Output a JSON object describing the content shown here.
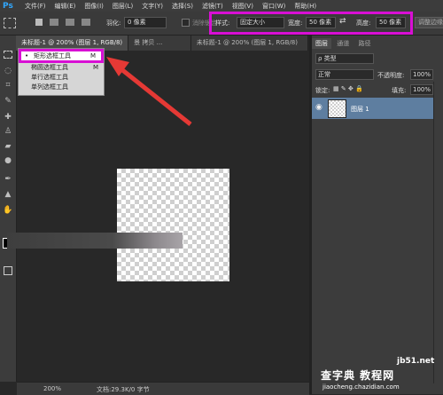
{
  "menubar": {
    "logo": "Ps",
    "items": [
      "文件(F)",
      "编辑(E)",
      "图像(I)",
      "图层(L)",
      "文字(Y)",
      "选择(S)",
      "滤镜(T)",
      "视图(V)",
      "窗口(W)",
      "帮助(H)"
    ]
  },
  "options": {
    "feather_label": "羽化:",
    "feather_value": "0 像素",
    "antialias_label": "消除锯齿",
    "style_label": "样式:",
    "style_value": "固定大小",
    "width_label": "宽度:",
    "width_value": "50 像素",
    "swap_icon": "⇄",
    "height_label": "高度:",
    "height_value": "50 像素",
    "refine_button": "调整边缘"
  },
  "tabs": [
    {
      "label": "未标题-1 @ 200% (图层 1, RGB/8)",
      "active": true
    },
    {
      "label": "景 拷贝 ...",
      "active": false
    },
    {
      "label": "未标题-1 @ 200% (图层 1, RGB/8)",
      "active": false
    }
  ],
  "flyout": {
    "items": [
      {
        "label": "矩形选框工具",
        "key": "M",
        "selected": true
      },
      {
        "label": "椭圆选框工具",
        "key": "M",
        "selected": false
      },
      {
        "label": "单行选框工具",
        "key": "",
        "selected": false
      },
      {
        "label": "单列选框工具",
        "key": "",
        "selected": false
      }
    ]
  },
  "status": {
    "zoom": "200%",
    "doc": "文档:29.3K/0 字节"
  },
  "panel": {
    "tabs": [
      "图层",
      "通道",
      "路径"
    ],
    "kind": "类型",
    "blend": "正常",
    "opacity_label": "不透明度:",
    "opacity_value": "100%",
    "lock_label": "锁定:",
    "fill_label": "填充:",
    "fill_value": "100%",
    "layer_name": "图层 1"
  },
  "watermark": {
    "line1": "jb51.net",
    "line2": "查字典 教程网",
    "line3": "jiaocheng.chazidian.com"
  },
  "colors": {
    "highlight": "#d80fd4",
    "arrow": "#e53935",
    "layer_selected": "#5e7ea0"
  }
}
